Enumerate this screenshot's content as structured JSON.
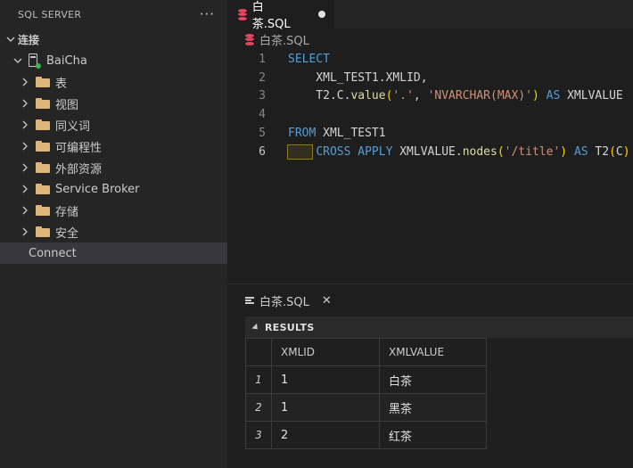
{
  "sidebar": {
    "title": "SQL SERVER",
    "more": "···",
    "section": "连接",
    "server": "BaiCha",
    "folders": [
      "表",
      "视图",
      "同义词",
      "可编程性",
      "外部资源",
      "Service Broker",
      "存储",
      "安全"
    ],
    "connect": "Connect"
  },
  "editor": {
    "tab_label": "白茶.SQL",
    "breadcrumb": "白茶.SQL",
    "line_numbers": [
      "1",
      "2",
      "3",
      "4",
      "5",
      "6"
    ]
  },
  "panel": {
    "tab_label": "白茶.SQL",
    "close": "✕",
    "results_title": "RESULTS",
    "columns": [
      "XMLID",
      "XMLVALUE"
    ],
    "rows": [
      {
        "index": "1",
        "xmlid": "1",
        "xmlvalue": "白茶"
      },
      {
        "index": "2",
        "xmlid": "1",
        "xmlvalue": "黑茶"
      },
      {
        "index": "3",
        "xmlid": "2",
        "xmlvalue": "红茶"
      }
    ]
  },
  "colors": {
    "keyword": "#569cd6",
    "function": "#dcdcaa",
    "string": "#ce9178",
    "bracket": "#ffd700",
    "folder": "#dcb67a",
    "db_icon": "#e2455f",
    "connected": "#3bb44a"
  },
  "icons": [
    "folder-icon",
    "server-icon",
    "database-icon",
    "chevron-right-icon",
    "chevron-down-icon",
    "close-icon",
    "lines-icon"
  ]
}
